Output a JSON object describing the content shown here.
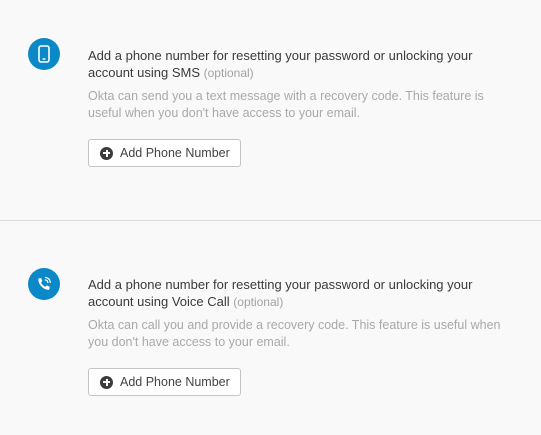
{
  "sms": {
    "icon": "mobile-phone-icon",
    "title": "Add a phone number for resetting your password or unlocking your account using SMS",
    "optional": "(optional)",
    "description": "Okta can send you a text message with a recovery code. This feature is useful when you don't have access to your email.",
    "button_label": "Add Phone Number"
  },
  "voice": {
    "icon": "phone-call-icon",
    "title": "Add a phone number for resetting your password or unlocking your account using Voice Call",
    "optional": "(optional)",
    "description": "Okta can call you and provide a recovery code. This feature is useful when you don't have access to your email.",
    "button_label": "Add Phone Number"
  },
  "colors": {
    "accent": "#0a88c8",
    "background": "#f9f9f9",
    "divider": "#dcdcdc"
  }
}
